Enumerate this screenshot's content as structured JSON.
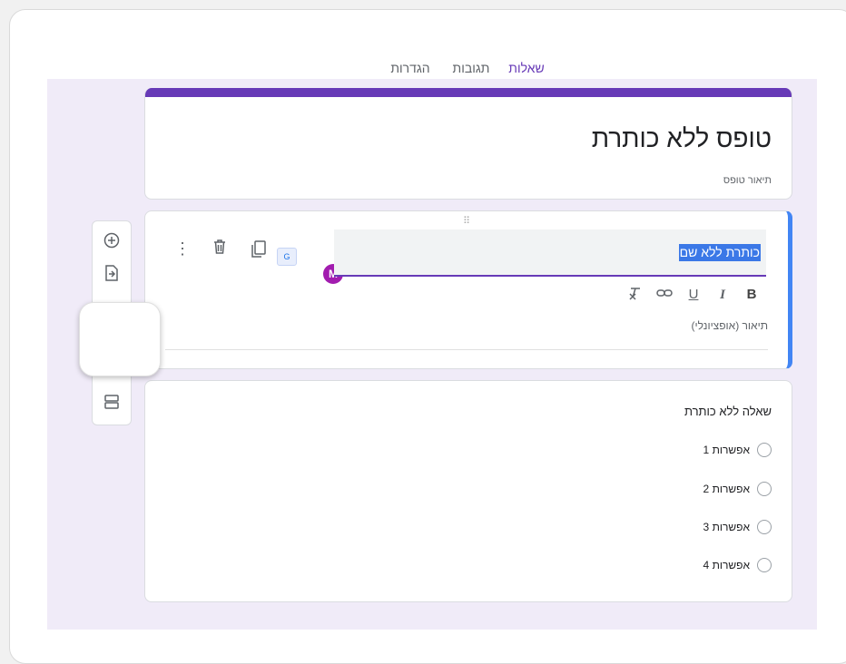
{
  "tabs": [
    {
      "label": "שאלות",
      "active": true
    },
    {
      "label": "תגובות",
      "active": false
    },
    {
      "label": "הגדרות",
      "active": false
    }
  ],
  "form": {
    "title": "טופס ללא כותרת",
    "description_placeholder": "תיאור טופס"
  },
  "section": {
    "title_selected": "כותרת ללא שם",
    "description_placeholder": "תיאור (אופציונלי)",
    "format_buttons": [
      "B",
      "I",
      "U",
      "link",
      "clear-format"
    ],
    "drag_handle": "⠿"
  },
  "question": {
    "title": "שאלה ללא כותרת",
    "options": [
      "אפשרות 1",
      "אפשרות 2",
      "אפשרות 3",
      "אפשרות 4"
    ]
  },
  "sidebar": {
    "icons": [
      "add-question-icon",
      "import-questions-icon",
      "add-section-icon"
    ]
  },
  "colors": {
    "accent": "#673ab7",
    "focus_border": "#4285f4",
    "canvas_bg": "#f0ebf8"
  }
}
